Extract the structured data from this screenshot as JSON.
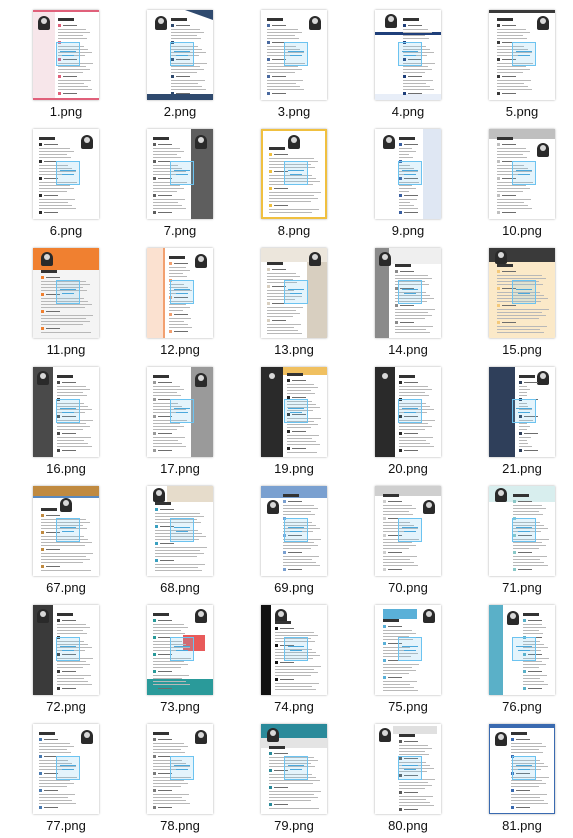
{
  "files": [
    {
      "name": "1.png",
      "accent": "#e0607a",
      "style": "pink"
    },
    {
      "name": "2.png",
      "accent": "#2f4a6e",
      "style": "navy-corner"
    },
    {
      "name": "3.png",
      "accent": "#4a6aa0",
      "style": "plain"
    },
    {
      "name": "4.png",
      "accent": "#1f3f7a",
      "style": "blue-band"
    },
    {
      "name": "5.png",
      "accent": "#3a3a3a",
      "style": "plain-top"
    },
    {
      "name": "6.png",
      "accent": "#2b2b2b",
      "style": "plain"
    },
    {
      "name": "7.png",
      "accent": "#5e5e5e",
      "style": "gray-right"
    },
    {
      "name": "8.png",
      "accent": "#f0c040",
      "style": "yellow-frame"
    },
    {
      "name": "9.png",
      "accent": "#3a5fa0",
      "style": "blue-side"
    },
    {
      "name": "10.png",
      "accent": "#bfbfbf",
      "style": "gray-header"
    },
    {
      "name": "11.png",
      "accent": "#f08030",
      "style": "orange"
    },
    {
      "name": "12.png",
      "accent": "#f2a070",
      "style": "peach-left"
    },
    {
      "name": "13.png",
      "accent": "#d8cfc0",
      "style": "beige-right"
    },
    {
      "name": "14.png",
      "accent": "#8a8a8a",
      "style": "gray-left"
    },
    {
      "name": "15.png",
      "accent": "#f4c97a",
      "style": "cream"
    },
    {
      "name": "16.png",
      "accent": "#4a4a4a",
      "style": "dark-left"
    },
    {
      "name": "17.png",
      "accent": "#9a9a9a",
      "style": "gray-right"
    },
    {
      "name": "19.png",
      "accent": "#2a2a2a",
      "style": "dark-gold"
    },
    {
      "name": "20.png",
      "accent": "#2a2a2a",
      "style": "dark-left"
    },
    {
      "name": "21.png",
      "accent": "#2f3f5a",
      "style": "navy-left"
    },
    {
      "name": "67.png",
      "accent": "#c08a40",
      "style": "brown-top"
    },
    {
      "name": "68.png",
      "accent": "#3aa0c0",
      "style": "teal-block"
    },
    {
      "name": "69.png",
      "accent": "#7aa0d0",
      "style": "blue-header"
    },
    {
      "name": "70.png",
      "accent": "#cfcfcf",
      "style": "gray-header"
    },
    {
      "name": "71.png",
      "accent": "#8ac8c8",
      "style": "mint-header"
    },
    {
      "name": "72.png",
      "accent": "#3a3a3a",
      "style": "dark-left"
    },
    {
      "name": "73.png",
      "accent": "#2a9a9a",
      "style": "teal-wave"
    },
    {
      "name": "74.png",
      "accent": "#111111",
      "style": "black-left"
    },
    {
      "name": "75.png",
      "accent": "#5ab0d8",
      "style": "sky-header"
    },
    {
      "name": "76.png",
      "accent": "#5ab0c8",
      "style": "teal-left"
    },
    {
      "name": "77.png",
      "accent": "#4a7ab0",
      "style": "plain"
    },
    {
      "name": "78.png",
      "accent": "#7a7a7a",
      "style": "plain"
    },
    {
      "name": "79.png",
      "accent": "#2a8a9a",
      "style": "teal-header"
    },
    {
      "name": "80.png",
      "accent": "#5a5a5a",
      "style": "gray-tabs"
    },
    {
      "name": "81.png",
      "accent": "#3a6ab0",
      "style": "blue-frame"
    }
  ]
}
